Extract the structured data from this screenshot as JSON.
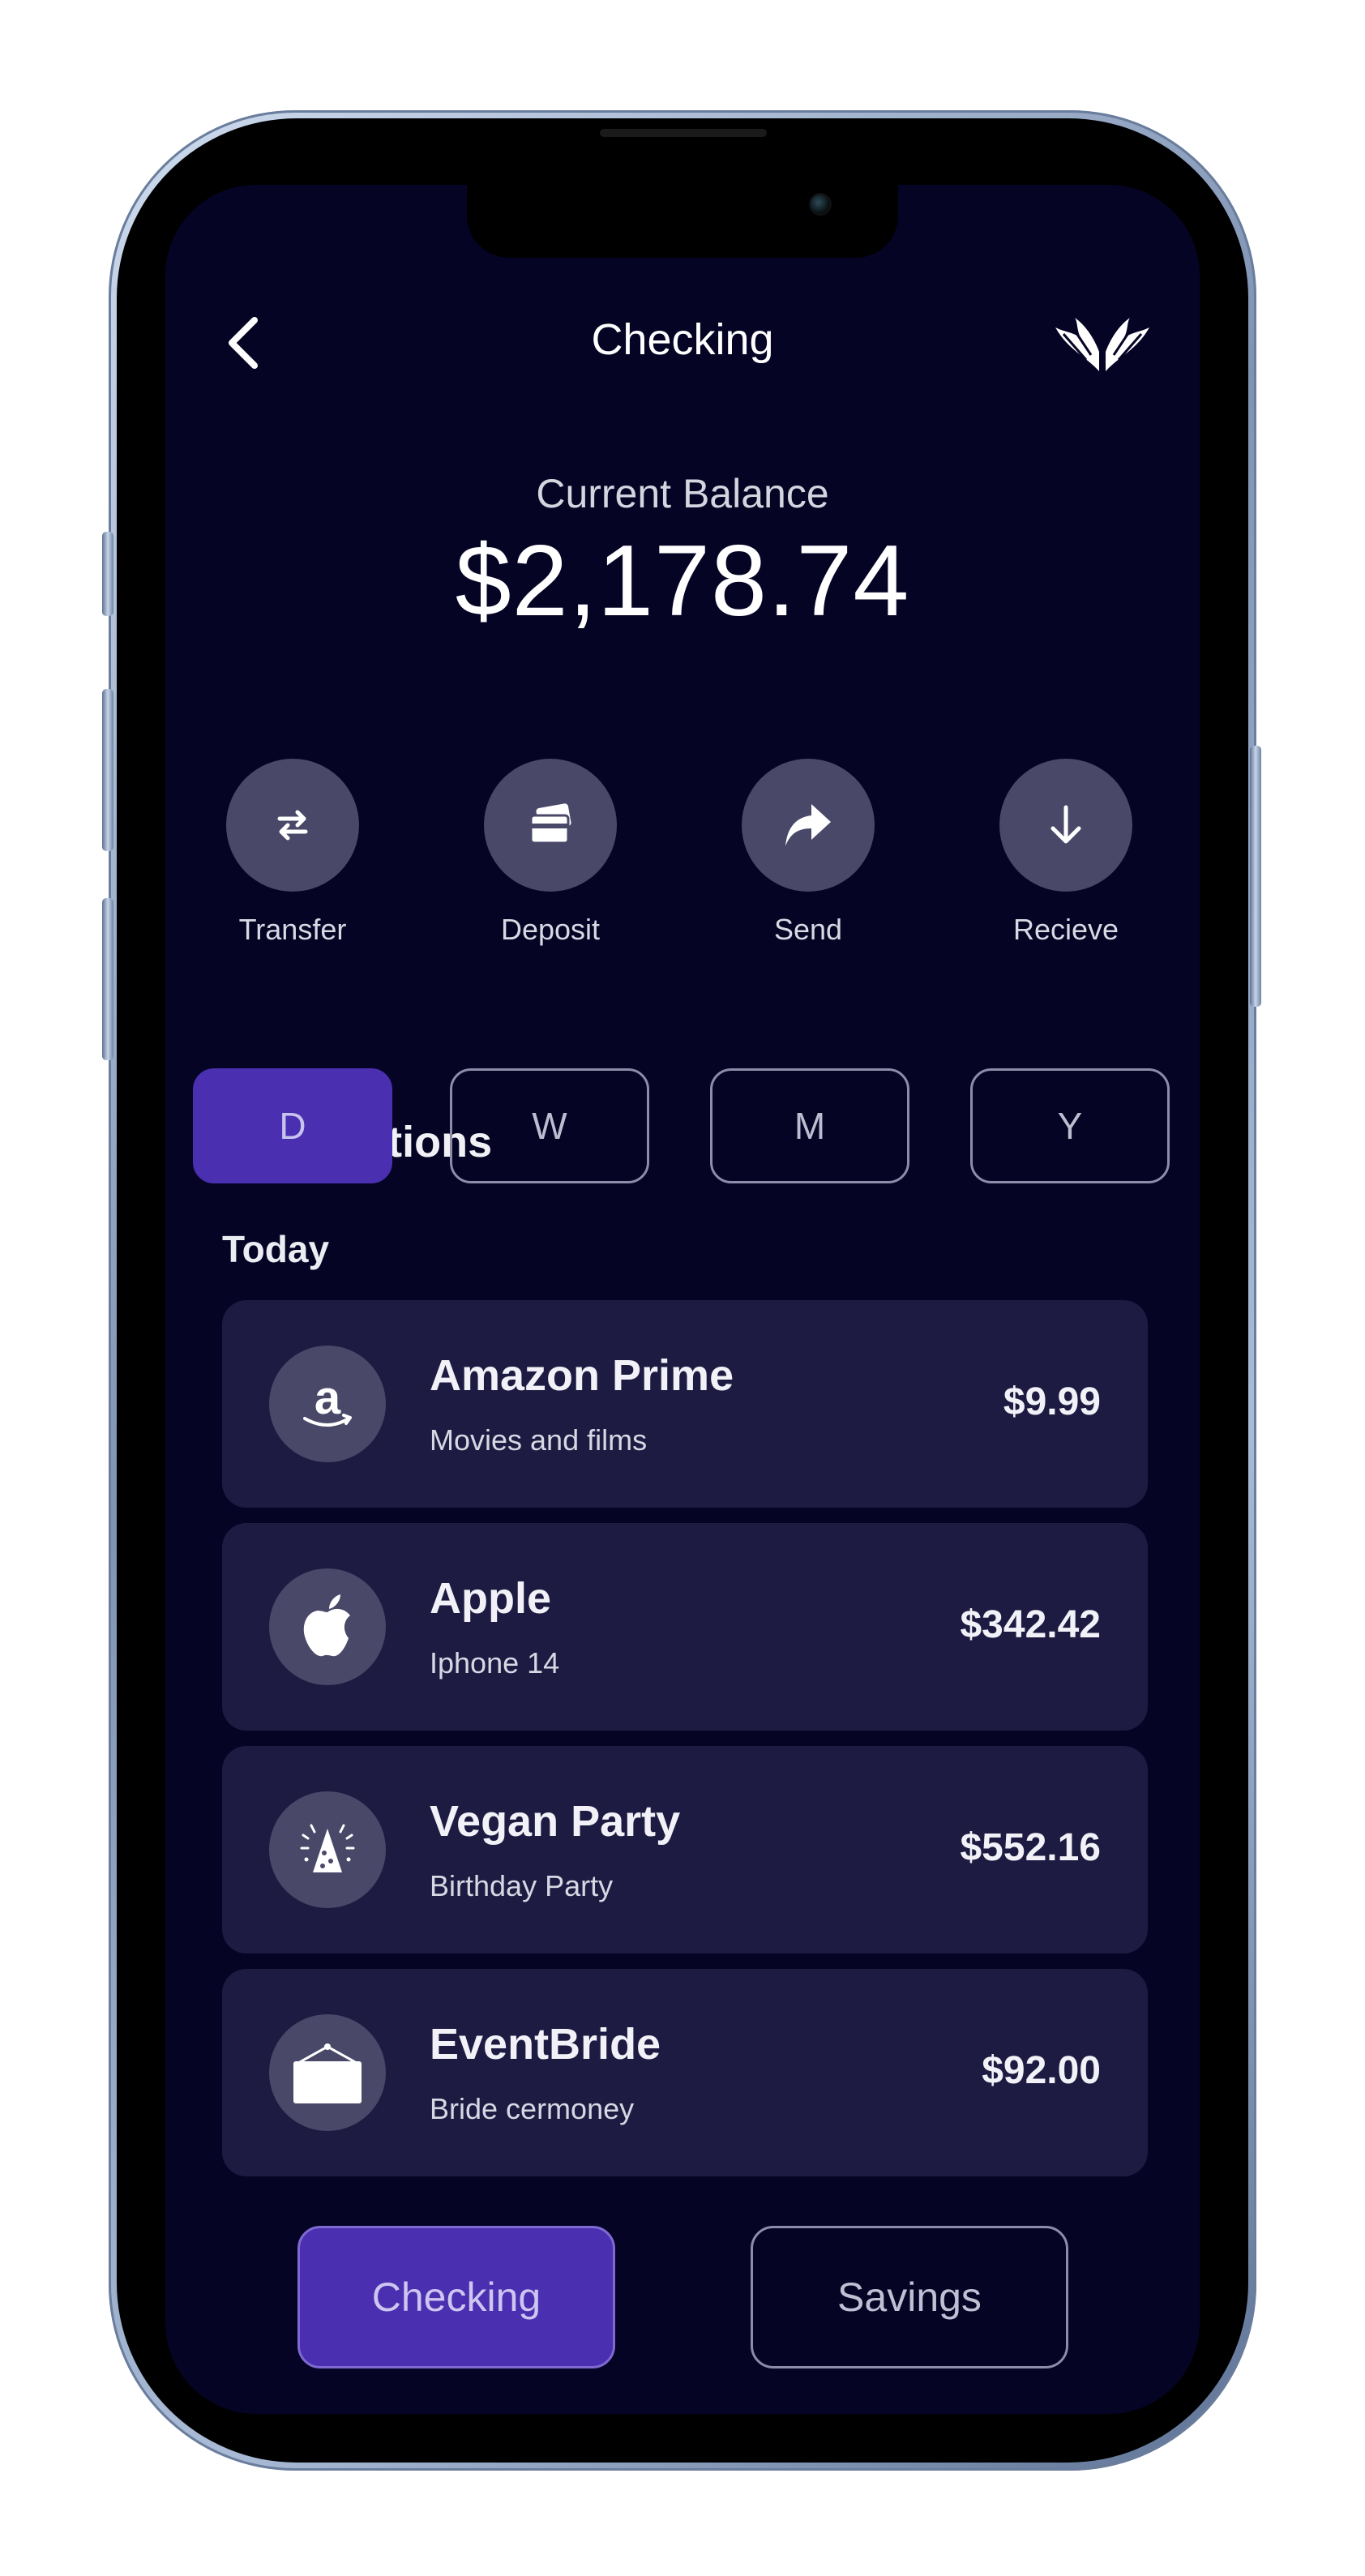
{
  "header": {
    "title": "Checking",
    "back_icon": "chevron-left-icon",
    "logo_icon": "wings-logo-icon"
  },
  "balance": {
    "label": "Current Balance",
    "value": "$2,178.74"
  },
  "actions": [
    {
      "label": "Transfer",
      "icon": "transfer-arrows-icon"
    },
    {
      "label": "Deposit",
      "icon": "cards-icon"
    },
    {
      "label": "Send",
      "icon": "share-arrow-icon"
    },
    {
      "label": "Recieve",
      "icon": "arrow-down-icon"
    }
  ],
  "transactions": {
    "title": "Transactions",
    "periods": [
      "D",
      "W",
      "M",
      "Y"
    ],
    "selected_period": "D",
    "group_label": "Today",
    "items": [
      {
        "name": "Amazon Prime",
        "subtitle": "Movies and films",
        "amount": "$9.99",
        "icon": "amazon-icon"
      },
      {
        "name": "Apple",
        "subtitle": "Iphone 14",
        "amount": "$342.42",
        "icon": "apple-icon"
      },
      {
        "name": "Vegan Party",
        "subtitle": "Birthday Party",
        "amount": "$552.16",
        "icon": "party-hat-icon"
      },
      {
        "name": "EventBride",
        "subtitle": "Bride cermoney",
        "amount": "$92.00",
        "icon": "hanging-sign-icon"
      }
    ]
  },
  "bottom_tabs": {
    "items": [
      "Checking",
      "Savings"
    ],
    "selected": "Checking"
  },
  "colors": {
    "background": "#050425",
    "card": "#1d1b42",
    "icon_circle": "#4a4868",
    "accent": "#4a2fb1"
  }
}
